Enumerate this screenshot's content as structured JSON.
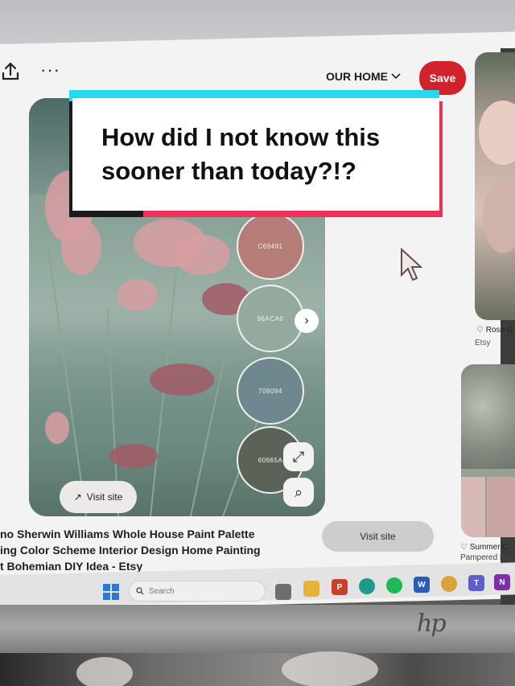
{
  "toolbar": {
    "share_icon": "share-icon",
    "more_icon": "more-icon",
    "more_label": "···",
    "board_label": "OUR HOME",
    "save_label": "Save"
  },
  "pin": {
    "swatches": [
      {
        "code": "C69491",
        "color": "#b57d78"
      },
      {
        "code": "96ACA0",
        "color": "#94aa9f"
      },
      {
        "code": "709094",
        "color": "#6f8890"
      },
      {
        "code": "60665A",
        "color": "#5b6358"
      }
    ],
    "next_icon": "chevron-right-icon",
    "next_label": "›",
    "expand_icon": "expand-icon",
    "expand_label": "⤢",
    "lens_icon": "visual-search-icon",
    "lens_label": "⌕",
    "visit_overlay_label": "Visit site",
    "visit_overlay_arrow": "↗",
    "title_lines": [
      "no Sherwin Williams Whole House Paint Palette",
      "ing Color Scheme Interior Design Home Painting",
      "t Bohemian DIY Idea - Etsy"
    ],
    "visit_button_label": "Visit site"
  },
  "side": {
    "pin1_title": "Rose G",
    "pin1_source": "Etsy",
    "pin2_title": "Summer C",
    "pin2_source": "Pampered Pre"
  },
  "taskbar": {
    "search_placeholder": "Search",
    "apps": [
      "file-explorer",
      "powerpoint",
      "edge",
      "spotify",
      "word",
      "chrome",
      "teams",
      "onenote"
    ]
  },
  "caption": {
    "line1": "How did I not know this",
    "line2": "sooner than today?!?"
  },
  "brand": {
    "monitor_logo": "hp"
  },
  "colors": {
    "save": "#d1222b",
    "caption_cyan": "#25d9ef",
    "caption_red": "#f0305b"
  }
}
